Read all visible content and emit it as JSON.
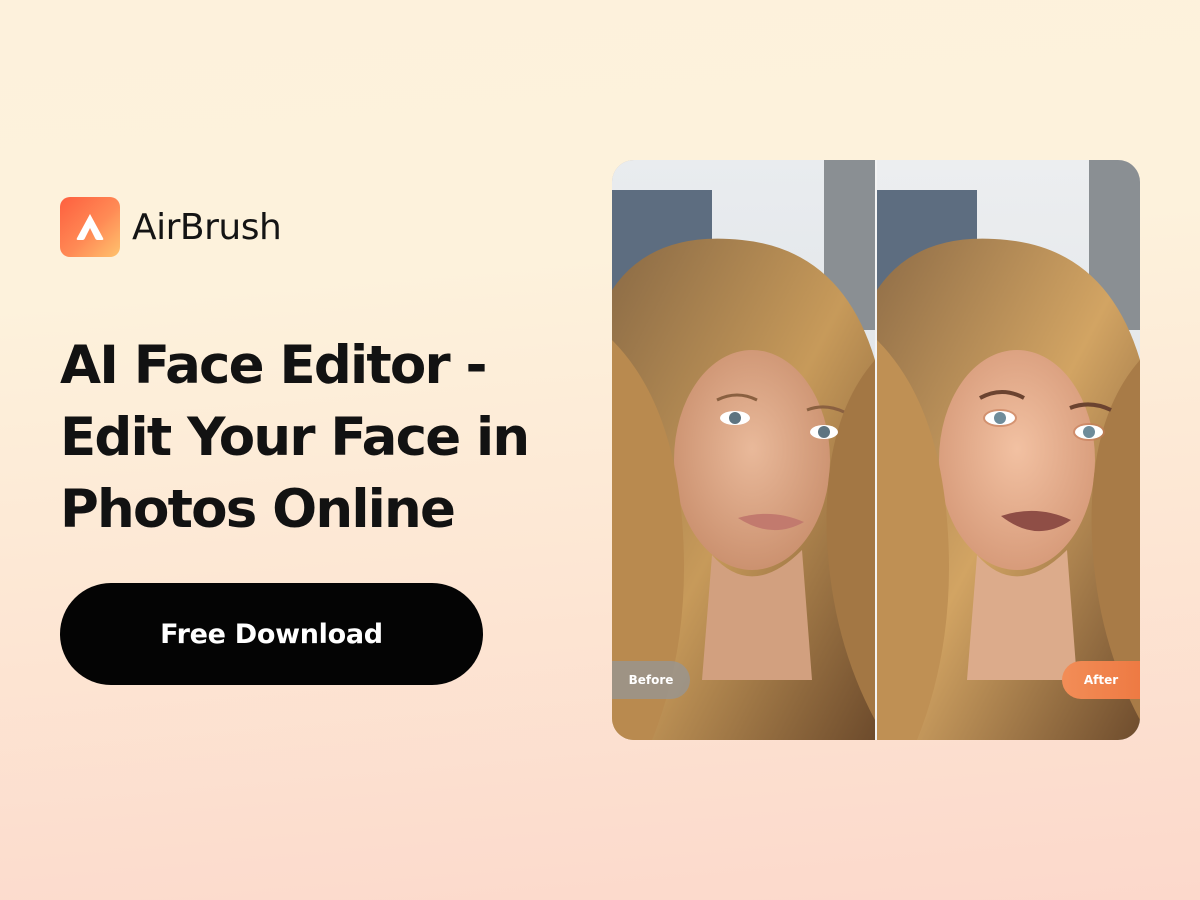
{
  "brand": {
    "name": "AirBrush",
    "logo_icon": "airbrush-a-logo-icon",
    "logo_gradient": [
      "#fe5f3f",
      "#ffc36e"
    ]
  },
  "hero": {
    "headline_lines": [
      "AI Face Editor -",
      "Edit Your Face in",
      "Photos Online"
    ]
  },
  "cta": {
    "label": "Free Download",
    "color": "#040404"
  },
  "comparison": {
    "before_label": "Before",
    "after_label": "After",
    "after_accent": "#ee7a43"
  }
}
